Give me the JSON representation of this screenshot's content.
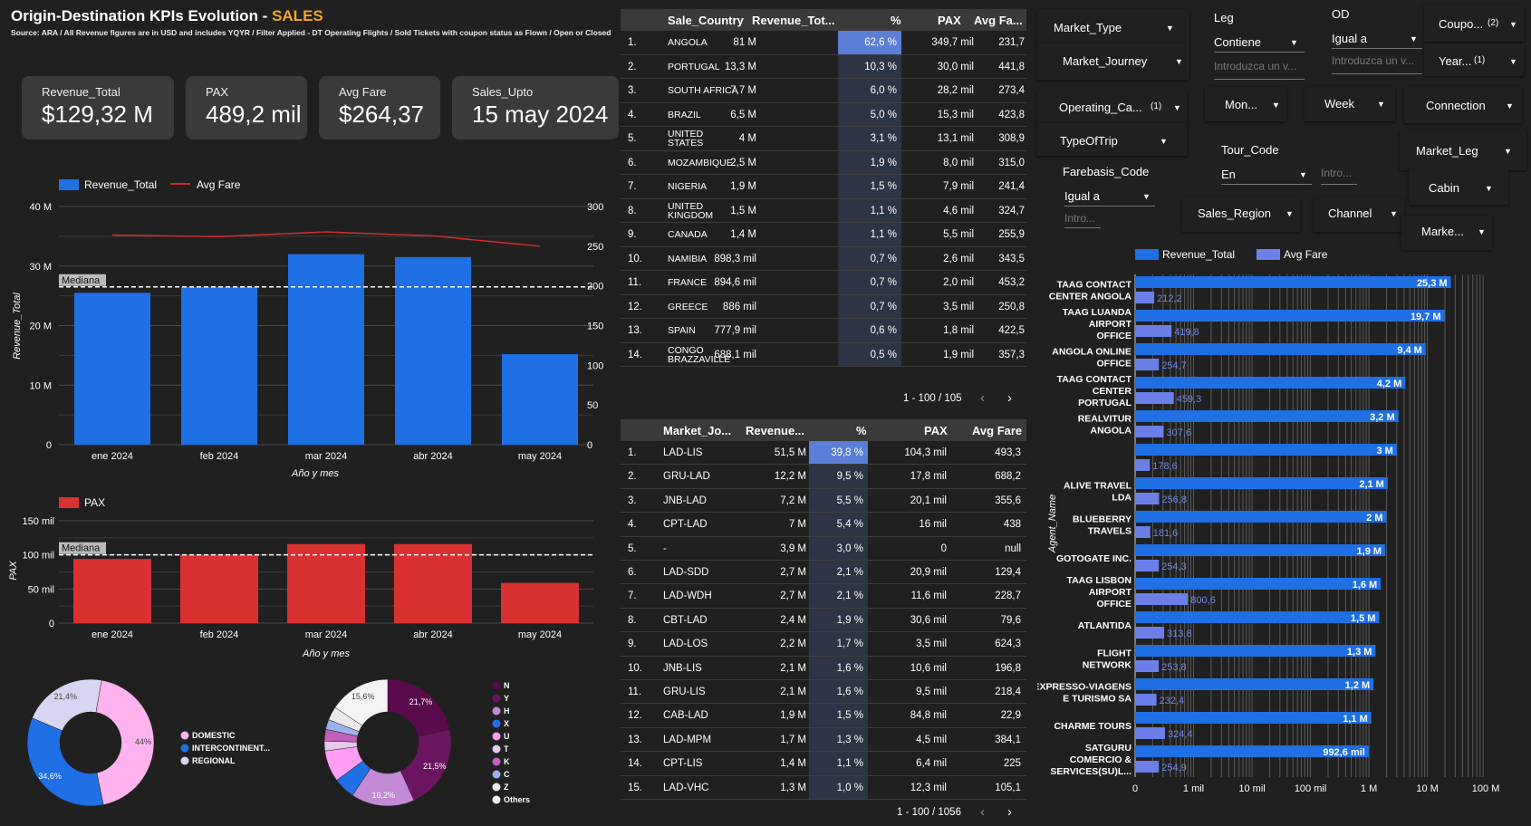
{
  "header": {
    "title_main": "Origin-Destination KPIs Evolution - ",
    "title_accent": "SALES",
    "subtitle": "Source: ARA / All Revenue figures are in USD and includes YQYR / Filter Applied - DT Operating Flights / Sold Tickets with coupon status as Flown / Open or Closed"
  },
  "kpis": [
    {
      "label": "Revenue_Total",
      "value": "$129,32 M"
    },
    {
      "label": "PAX",
      "value": "489,2 mil"
    },
    {
      "label": "Avg Fare",
      "value": "$264,37"
    },
    {
      "label": "Sales_Upto",
      "value": "15 may 2024"
    }
  ],
  "colors": {
    "accent": "#f5a623",
    "revenue_blue": "#1f6fe5",
    "avgfare_red": "#d62b2b",
    "pax_red": "#d93131",
    "avgfare_purple": "#6a80e8"
  },
  "chart_data": [
    {
      "type": "bar",
      "title": "",
      "categories": [
        "ene 2024",
        "feb 2024",
        "mar 2024",
        "abr 2024",
        "may 2024"
      ],
      "series": [
        {
          "name": "Revenue_Total",
          "values": [
            25.5,
            26.5,
            32.0,
            31.5,
            15.2
          ],
          "axis": "left"
        },
        {
          "name": "Avg Fare",
          "values": [
            264,
            262,
            268,
            263,
            250
          ],
          "axis": "right",
          "type": "line"
        }
      ],
      "xlabel": "Año y mes",
      "ylabel": "Revenue_Total",
      "yticks": [
        "0",
        "10 M",
        "20 M",
        "30 M",
        "40 M"
      ],
      "ylim": [
        0,
        40
      ],
      "y2ticks": [
        "0",
        "50",
        "100",
        "150",
        "200",
        "250",
        "300"
      ],
      "y2lim": [
        0,
        300
      ],
      "median_label": "Mediana",
      "median": 26.5,
      "legend": "top-left"
    },
    {
      "type": "bar",
      "title": "",
      "categories": [
        "ene 2024",
        "feb 2024",
        "mar 2024",
        "abr 2024",
        "may 2024"
      ],
      "series": [
        {
          "name": "PAX",
          "values": [
            94,
            100,
            116,
            116,
            59
          ]
        }
      ],
      "xlabel": "Año y mes",
      "ylabel": "PAX",
      "yticks": [
        "0",
        "50 mil",
        "100 mil",
        "150 mil"
      ],
      "ylim": [
        0,
        150
      ],
      "median_label": "Mediana",
      "median": 100,
      "legend": "top-left"
    },
    {
      "type": "pie",
      "labels": [
        "DOMESTIC",
        "INTERCONTINENT...",
        "REGIONAL"
      ],
      "values": [
        44.0,
        34.6,
        21.4
      ],
      "value_labels": [
        "44%",
        "34,6%",
        "21,4%"
      ],
      "colors": [
        "#ffb3ee",
        "#1f6fe5",
        "#d6d6f2"
      ]
    },
    {
      "type": "pie",
      "labels": [
        "N",
        "Y",
        "H",
        "X",
        "U",
        "T",
        "K",
        "C",
        "Z",
        "Others"
      ],
      "values": [
        21.7,
        21.5,
        16.2,
        5.5,
        8.0,
        2.5,
        3.0,
        2.5,
        3.5,
        15.6
      ],
      "value_labels": [
        "21,7%",
        "21,5%",
        "16,2%",
        "",
        "",
        "",
        "",
        "",
        "",
        "15,6%"
      ],
      "colors": [
        "#5a0b4d",
        "#6b1560",
        "#c38ad6",
        "#1f6fe5",
        "#ff9ef2",
        "#e6c8ec",
        "#c060b8",
        "#9bb0ef",
        "#ece9ec",
        "#f4f4f4"
      ]
    },
    {
      "type": "bar",
      "orientation": "horizontal",
      "title": "",
      "ylabel": "Agent_Name",
      "xscale": "log",
      "xticks": [
        "0",
        "1 mil",
        "10 mil",
        "100 mil",
        "1 M",
        "10 M",
        "100 M"
      ],
      "categories": [
        "TAAG CONTACT CENTER ANGOLA",
        "TAAG LUANDA AIRPORT OFFICE",
        "ANGOLA ONLINE OFFICE",
        "TAAG CONTACT CENTER PORTUGAL",
        "REALVITUR ANGOLA",
        "",
        "ALIVE TRAVEL LDA",
        "BLUEBERRY TRAVELS",
        "GOTOGATE INC.",
        "TAAG LISBON AIRPORT OFFICE",
        "ATLANTIDA",
        "FLIGHT NETWORK",
        "EXPRESSO-VIAGENS E TURISMO SA",
        "CHARME TOURS",
        "SATGURU COMERCIO & SERVICES(SU)L..."
      ],
      "series": [
        {
          "name": "Revenue_Total",
          "values": [
            25300000,
            19700000,
            9400000,
            4200000,
            3200000,
            3000000,
            2100000,
            2000000,
            1900000,
            1600000,
            1500000,
            1300000,
            1200000,
            1100000,
            992600
          ],
          "value_labels": [
            "25,3 M",
            "19,7 M",
            "9,4 M",
            "4,2 M",
            "3,2 M",
            "3 M",
            "2,1 M",
            "2 M",
            "1,9 M",
            "1,6 M",
            "1,5 M",
            "1,3 M",
            "1,2 M",
            "1,1 M",
            "992,6 mil"
          ]
        },
        {
          "name": "Avg Fare",
          "values": [
            212.2,
            419.8,
            254.7,
            459.3,
            307.6,
            178.6,
            256.8,
            181.6,
            254.3,
            800.6,
            313.8,
            253.8,
            232.4,
            324.4,
            254.9
          ],
          "value_labels": [
            "212,2",
            "419,8",
            "254,7",
            "459,3",
            "307,6",
            "178,6",
            "256,8",
            "181,6",
            "254,3",
            "800,6",
            "313,8",
            "253,8",
            "232,4",
            "324,4",
            "254,9"
          ]
        }
      ],
      "legend": "top-left"
    }
  ],
  "country_table": {
    "headers": [
      "Sale_Country",
      "Revenue_Tot...",
      "%",
      "PAX",
      "Avg Fa..."
    ],
    "rows": [
      [
        "1.",
        "ANGOLA",
        "",
        "81 M",
        "62,6 %",
        "349,7 mil",
        "231,7"
      ],
      [
        "2.",
        "PORTUGAL",
        "",
        "13,3 M",
        "10,3 %",
        "30,0 mil",
        "441,8"
      ],
      [
        "3.",
        "SOUTH AFRICA",
        "",
        "7,7 M",
        "6,0 %",
        "28,2 mil",
        "273,4"
      ],
      [
        "4.",
        "BRAZIL",
        "",
        "6,5 M",
        "5,0 %",
        "15,3 mil",
        "423,8"
      ],
      [
        "5.",
        "UNITED",
        "STATES",
        "4 M",
        "3,1 %",
        "13,1 mil",
        "308,9"
      ],
      [
        "6.",
        "MOZAMBIQUE",
        "",
        "2,5 M",
        "1,9 %",
        "8,0 mil",
        "315,0"
      ],
      [
        "7.",
        "NIGERIA",
        "",
        "1,9 M",
        "1,5 %",
        "7,9 mil",
        "241,4"
      ],
      [
        "8.",
        "UNITED",
        "KINGDOM",
        "1,5 M",
        "1,1 %",
        "4,6 mil",
        "324,7"
      ],
      [
        "9.",
        "CANADA",
        "",
        "1,4 M",
        "1,1 %",
        "5,5 mil",
        "255,9"
      ],
      [
        "10.",
        "NAMIBIA",
        "",
        "898,3 mil",
        "0,7 %",
        "2,6 mil",
        "343,5"
      ],
      [
        "11.",
        "FRANCE",
        "",
        "894,6 mil",
        "0,7 %",
        "2,0 mil",
        "453,2"
      ],
      [
        "12.",
        "GREECE",
        "",
        "886 mil",
        "0,7 %",
        "3,5 mil",
        "250,8"
      ],
      [
        "13.",
        "SPAIN",
        "",
        "777,9 mil",
        "0,6 %",
        "1,8 mil",
        "422,5"
      ],
      [
        "14.",
        "CONGO",
        "BRAZZAVILLE",
        "688,1 mil",
        "0,5 %",
        "1,9 mil",
        "357,3"
      ]
    ],
    "pct_fill": [
      0.626,
      0.103,
      0.06,
      0.05,
      0.031,
      0.019,
      0.015,
      0.011,
      0.011,
      0.007,
      0.007,
      0.007,
      0.006,
      0.005
    ],
    "pager": "1 - 100 / 105"
  },
  "journey_table": {
    "headers": [
      "Market_Jo...",
      "Revenue...",
      "%",
      "PAX",
      "Avg Fare"
    ],
    "rows": [
      [
        "1.",
        "LAD-LIS",
        "51,5 M",
        "39,8 %",
        "104,3 mil",
        "493,3"
      ],
      [
        "2.",
        "GRU-LAD",
        "12,2 M",
        "9,5 %",
        "17,8 mil",
        "688,2"
      ],
      [
        "3.",
        "JNB-LAD",
        "7,2 M",
        "5,5 %",
        "20,1 mil",
        "355,6"
      ],
      [
        "4.",
        "CPT-LAD",
        "7 M",
        "5,4 %",
        "16 mil",
        "438"
      ],
      [
        "5.",
        "-",
        "3,9 M",
        "3,0 %",
        "0",
        "null"
      ],
      [
        "6.",
        "LAD-SDD",
        "2,7 M",
        "2,1 %",
        "20,9 mil",
        "129,4"
      ],
      [
        "7.",
        "LAD-WDH",
        "2,7 M",
        "2,1 %",
        "11,6 mil",
        "228,7"
      ],
      [
        "8.",
        "CBT-LAD",
        "2,4 M",
        "1,9 %",
        "30,6 mil",
        "79,6"
      ],
      [
        "9.",
        "LAD-LOS",
        "2,2 M",
        "1,7 %",
        "3,5 mil",
        "624,3"
      ],
      [
        "10.",
        "JNB-LIS",
        "2,1 M",
        "1,6 %",
        "10,6 mil",
        "196,8"
      ],
      [
        "11.",
        "GRU-LIS",
        "2,1 M",
        "1,6 %",
        "9,5 mil",
        "218,4"
      ],
      [
        "12.",
        "CAB-LAD",
        "1,9 M",
        "1,5 %",
        "84,8 mil",
        "22,9"
      ],
      [
        "13.",
        "LAD-MPM",
        "1,7 M",
        "1,3 %",
        "4,5 mil",
        "384,1"
      ],
      [
        "14.",
        "CPT-LIS",
        "1,4 M",
        "1,1 %",
        "6,4 mil",
        "225"
      ],
      [
        "15.",
        "LAD-VHC",
        "1,3 M",
        "1,0 %",
        "12,3 mil",
        "105,1"
      ]
    ],
    "pct_fill": [
      0.398,
      0.095,
      0.055,
      0.054,
      0.03,
      0.021,
      0.021,
      0.019,
      0.017,
      0.016,
      0.016,
      0.015,
      0.013,
      0.011,
      0.01
    ],
    "pager": "1 - 100 / 1056"
  },
  "filters": {
    "market_type": "Market_Type",
    "leg_title": "Leg",
    "leg_op": "Contiene",
    "leg_placeholder": "Introduzca un v...",
    "od_title": "OD",
    "od_op": "Igual a",
    "od_placeholder": "Introduzca un v...",
    "coupon": "Coupo...",
    "coupon_count": "(2)",
    "market_journey": "Market_Journey",
    "year": "Year...",
    "year_count": "(1)",
    "operating_ca": "Operating_Ca...",
    "operating_count": "(1)",
    "month": "Mon...",
    "week": "Week",
    "connection": "Connection",
    "typeoftrip": "TypeOfTrip",
    "tour_code_title": "Tour_Code",
    "tour_code_op": "En",
    "tour_code_placeholder": "Intro...",
    "market_leg": "Market_Leg",
    "farebasis_title": "Farebasis_Code",
    "farebasis_op": "Igual a",
    "farebasis_placeholder": "Intro...",
    "cabin": "Cabin",
    "sales_region": "Sales_Region",
    "channel": "Channel",
    "marke": "Marke..."
  },
  "icons": {
    "dropdown": "caret-down-icon",
    "prev": "chevron-left-icon",
    "next": "chevron-right-icon"
  }
}
